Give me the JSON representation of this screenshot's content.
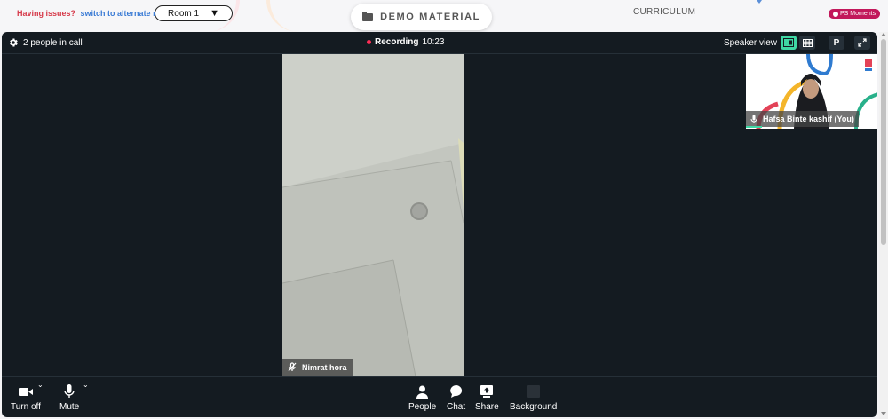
{
  "topbar": {
    "issues_question": "Having issues?",
    "issues_link": "switch to alternate room",
    "room_select": "Room 1",
    "demo_material": "DEMO MATERIAL",
    "curriculum": "CURRICULUM",
    "moments": "PS Moments"
  },
  "call": {
    "people_count": "2 people in call",
    "recording_label": "Recording",
    "recording_time": "10:23",
    "view_mode": "Speaker view",
    "p_button": "P"
  },
  "participants": {
    "main_name": "Nimrat hora",
    "self_name": "Hafsa Binte kashif (You)"
  },
  "controls": {
    "camera": "Turn off",
    "mic": "Mute",
    "people": "People",
    "chat": "Chat",
    "share": "Share",
    "background": "Background"
  },
  "colors": {
    "call_bg": "#141b21",
    "accent": "#3fd8a4",
    "recording": "#ff2d55",
    "issues": "#d63b4b",
    "link": "#3a7bd5"
  }
}
